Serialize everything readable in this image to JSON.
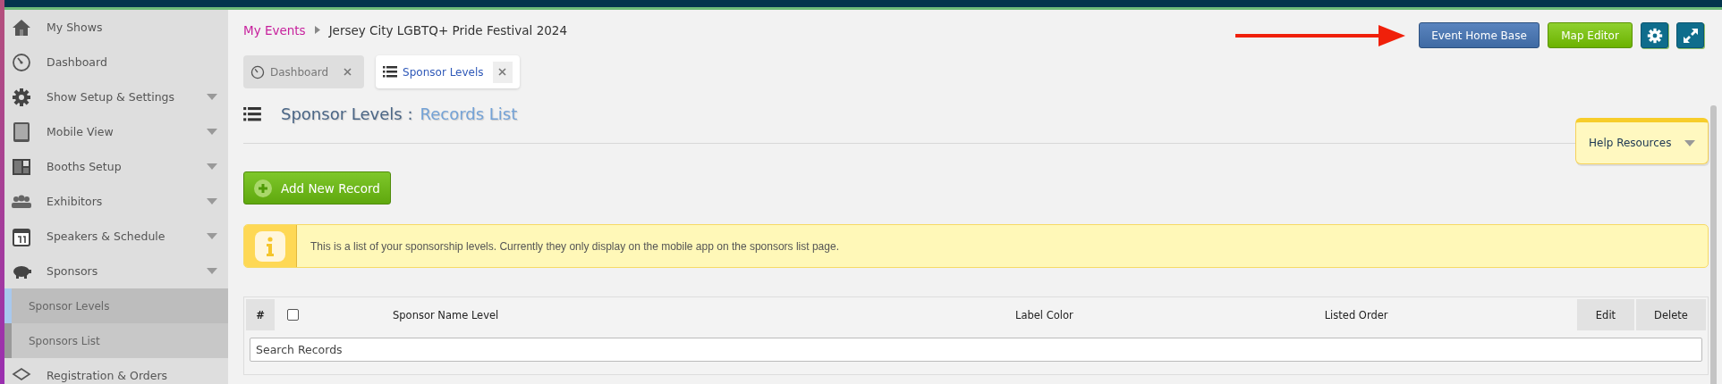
{
  "sidebar": {
    "items": [
      {
        "label": "My Shows",
        "expandable": false
      },
      {
        "label": "Dashboard",
        "expandable": false
      },
      {
        "label": "Show Setup & Settings",
        "expandable": true,
        "expanded": false
      },
      {
        "label": "Mobile View",
        "expandable": true,
        "expanded": false
      },
      {
        "label": "Booths Setup",
        "expandable": true,
        "expanded": false
      },
      {
        "label": "Exhibitors",
        "expandable": true,
        "expanded": false
      },
      {
        "label": "Speakers & Schedule",
        "expandable": true,
        "expanded": false
      },
      {
        "label": "Sponsors",
        "expandable": true,
        "expanded": true,
        "children": [
          {
            "label": "Sponsor Levels",
            "selected": true
          },
          {
            "label": "Sponsors List",
            "selected": false
          }
        ]
      },
      {
        "label": "Registration & Orders",
        "expandable": false
      }
    ]
  },
  "breadcrumb": {
    "link": "My Events",
    "current": "Jersey City LGBTQ+ Pride Festival 2024"
  },
  "header_buttons": [
    {
      "kind": "primary",
      "label": "Event Home Base"
    },
    {
      "kind": "success",
      "label": "Map Editor"
    },
    {
      "kind": "settings"
    },
    {
      "kind": "fullscreen"
    }
  ],
  "tabs": [
    {
      "label": "Dashboard",
      "selected": false
    },
    {
      "label": "Sponsor Levels",
      "selected": true
    }
  ],
  "page_title": {
    "title": "Sponsor Levels :",
    "subtitle": "Records List"
  },
  "help": {
    "label": "Help Resources"
  },
  "add_button": {
    "label": "Add New Record"
  },
  "info": {
    "text": "This is a list of your sponsorship levels. Currently they only display on the mobile app on the sponsors list page."
  },
  "table": {
    "columns": [
      {
        "kind": "index",
        "label": "#"
      },
      {
        "kind": "checkbox",
        "checked": false
      },
      {
        "kind": "text",
        "label": "Sponsor Name Level"
      },
      {
        "kind": "text",
        "label": "Label Color"
      },
      {
        "kind": "text",
        "label": "Listed Order"
      },
      {
        "kind": "action",
        "label": "Edit"
      },
      {
        "kind": "action",
        "label": "Delete"
      }
    ],
    "search": {
      "placeholder": "Search Records"
    }
  }
}
